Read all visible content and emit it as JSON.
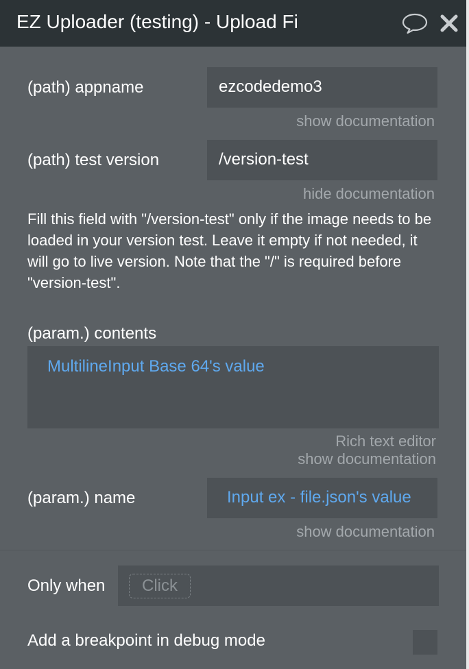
{
  "header": {
    "title": "EZ Uploader (testing) - Upload Fi",
    "comment_icon": "speech-bubble-icon",
    "close_icon": "close-x-icon"
  },
  "fields": {
    "appname": {
      "label": "(path) appname",
      "value": "ezcodedemo3",
      "doc_link": "show documentation"
    },
    "test_version": {
      "label": "(path) test version",
      "value": "/version-test",
      "doc_link": "hide documentation",
      "documentation": "Fill this field with \"/version-test\" only if the image needs to be loaded in your version test. Leave it empty if not needed, it will go to live version. Note that the \"/\" is required before \"version-test\"."
    },
    "contents": {
      "label": "(param.) contents",
      "value": "MultilineInput Base 64's value",
      "rich_text_link": "Rich text editor",
      "doc_link": "show documentation"
    },
    "name": {
      "label": "(param.) name",
      "value": "Input ex - file.json's value",
      "doc_link": "show documentation"
    }
  },
  "conditions": {
    "only_when_label": "Only when",
    "click_placeholder": "Click",
    "breakpoint_label": "Add a breakpoint in debug mode",
    "breakpoint_checked": false
  },
  "colors": {
    "header_bg": "#2c3336",
    "panel_bg": "#5b6064",
    "field_bg": "#4d5256",
    "dynamic_value": "#5fa9ef",
    "muted_link": "#a3a8ac"
  }
}
